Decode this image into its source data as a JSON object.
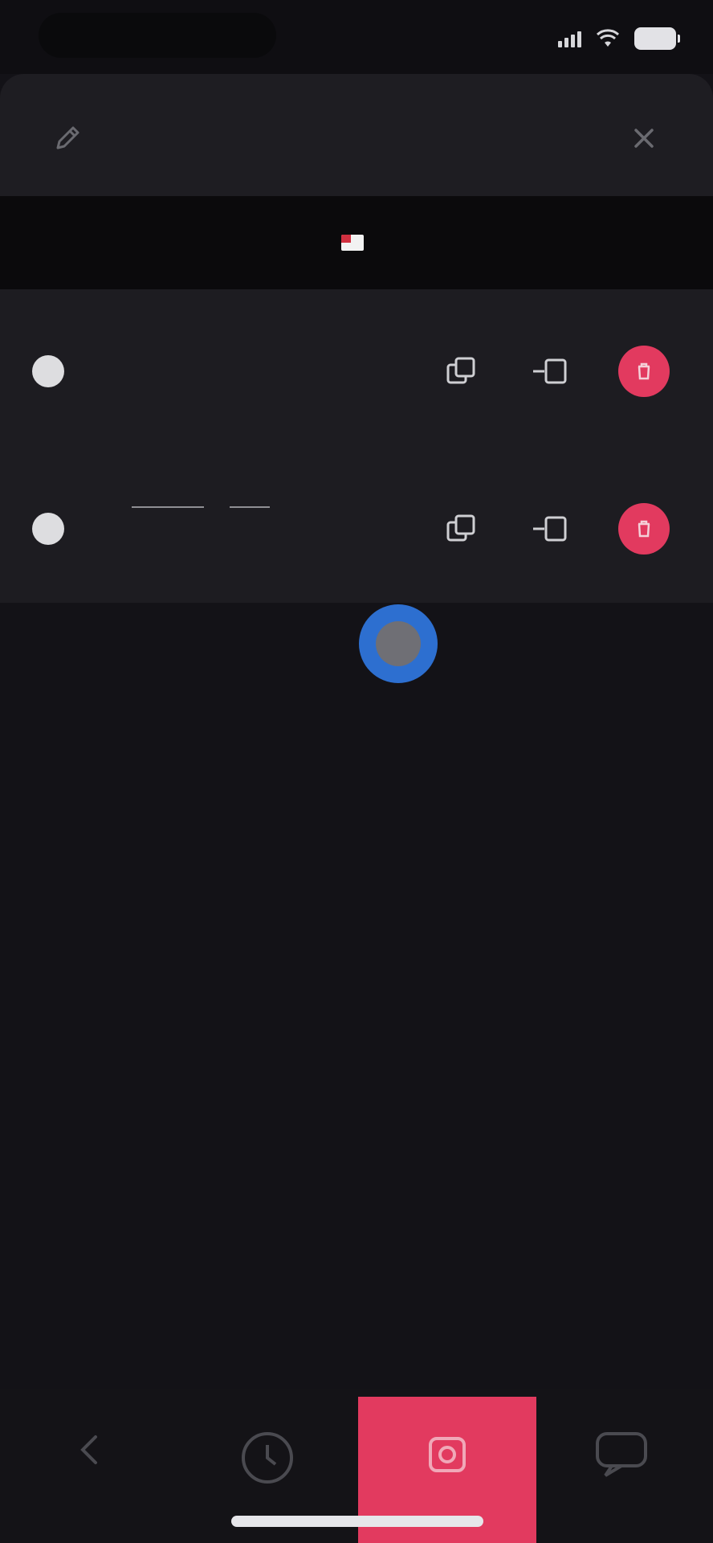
{
  "status_bar": {
    "left_label_bold": "",
    "left_label_dim": "",
    "icons": [
      "signal-icon",
      "wifi-icon",
      "battery-icon"
    ]
  },
  "nav": {
    "title": "",
    "left_icon": "pencil-icon",
    "right_icon": "close-icon"
  },
  "language": {
    "flag": "flag-icon",
    "label": ""
  },
  "list": [
    {
      "expression": "",
      "actions": [
        "copy-icon",
        "share-icon",
        "delete-icon"
      ]
    },
    {
      "expression_parts": [],
      "actions": [
        "copy-icon",
        "share-icon",
        "delete-icon"
      ]
    }
  ],
  "tab_bar": {
    "tabs": [
      "back-icon",
      "history-icon",
      "camera-icon",
      "chat-icon"
    ],
    "active_index": 2
  },
  "colors": {
    "accent": "#e23a5f",
    "background": "#131217",
    "panel": "#1d1c21",
    "touch": "#2d6fd0"
  }
}
